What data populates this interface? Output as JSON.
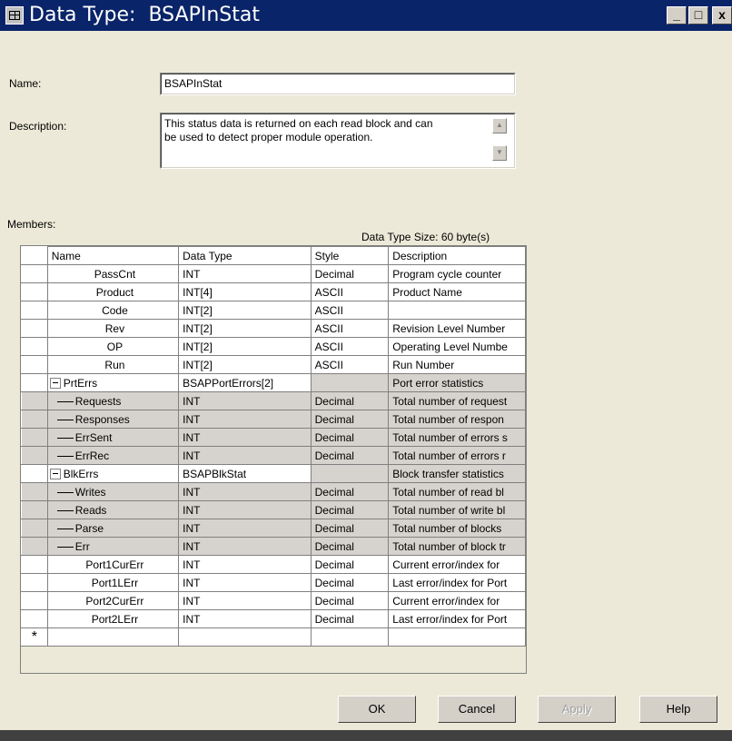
{
  "window": {
    "title": "Data Type:  BSAPInStat",
    "minimize": "_",
    "maximize": "□",
    "close": "x"
  },
  "form": {
    "name_label": "Name:",
    "name_value": "BSAPInStat",
    "description_label": "Description:",
    "description_line1": "This status data is returned on each read block and can",
    "description_line2": "be used to detect proper module operation.",
    "members_label": "Members:",
    "size_label": "Data Type Size: 60 byte(s)"
  },
  "table": {
    "headers": [
      "Name",
      "Data Type",
      "Style",
      "Description"
    ],
    "rows": [
      {
        "kind": "white",
        "name": "PassCnt",
        "type": "INT",
        "style": "Decimal",
        "desc": "Program cycle counter"
      },
      {
        "kind": "white",
        "name": "Product",
        "type": "INT[4]",
        "style": "ASCII",
        "desc": "Product Name"
      },
      {
        "kind": "white",
        "name": "Code",
        "type": "INT[2]",
        "style": "ASCII",
        "desc": ""
      },
      {
        "kind": "white",
        "name": "Rev",
        "type": "INT[2]",
        "style": "ASCII",
        "desc": "Revision Level Number"
      },
      {
        "kind": "white",
        "name": "OP",
        "type": "INT[2]",
        "style": "ASCII",
        "desc": "Operating Level Numbe"
      },
      {
        "kind": "white",
        "name": "Run",
        "type": "INT[2]",
        "style": "ASCII",
        "desc": "Run Number"
      },
      {
        "kind": "group",
        "name": "PrtErrs",
        "type": "BSAPPortErrors[2]",
        "style": "",
        "desc": "Port error statistics"
      },
      {
        "kind": "sub",
        "name": "Requests",
        "type": "INT",
        "style": "Decimal",
        "desc": "Total number of request"
      },
      {
        "kind": "sub",
        "name": "Responses",
        "type": "INT",
        "style": "Decimal",
        "desc": "Total number of respon"
      },
      {
        "kind": "sub",
        "name": "ErrSent",
        "type": "INT",
        "style": "Decimal",
        "desc": "Total number of errors s"
      },
      {
        "kind": "sub",
        "name": "ErrRec",
        "type": "INT",
        "style": "Decimal",
        "desc": "Total number of errors r"
      },
      {
        "kind": "group2",
        "name": "BlkErrs",
        "type": "BSAPBlkStat",
        "style": "",
        "desc": "Block transfer statistics"
      },
      {
        "kind": "sub",
        "name": "Writes",
        "type": "INT",
        "style": "Decimal",
        "desc": "Total number of read bl"
      },
      {
        "kind": "sub",
        "name": "Reads",
        "type": "INT",
        "style": "Decimal",
        "desc": "Total number of write bl"
      },
      {
        "kind": "sub",
        "name": "Parse",
        "type": "INT",
        "style": "Decimal",
        "desc": "Total number of blocks"
      },
      {
        "kind": "sub",
        "name": "Err",
        "type": "INT",
        "style": "Decimal",
        "desc": "Total number of block tr"
      },
      {
        "kind": "white",
        "name": "Port1CurErr",
        "type": "INT",
        "style": "Decimal",
        "desc": "Current error/index for"
      },
      {
        "kind": "white",
        "name": "Port1LErr",
        "type": "INT",
        "style": "Decimal",
        "desc": "Last error/index for Port"
      },
      {
        "kind": "white",
        "name": "Port2CurErr",
        "type": "INT",
        "style": "Decimal",
        "desc": "Current error/index for"
      },
      {
        "kind": "white",
        "name": "Port2LErr",
        "type": "INT",
        "style": "Decimal",
        "desc": "Last error/index for Port"
      }
    ],
    "new_row_marker": "*"
  },
  "buttons": {
    "ok": "OK",
    "cancel": "Cancel",
    "apply": "Apply",
    "help": "Help"
  }
}
